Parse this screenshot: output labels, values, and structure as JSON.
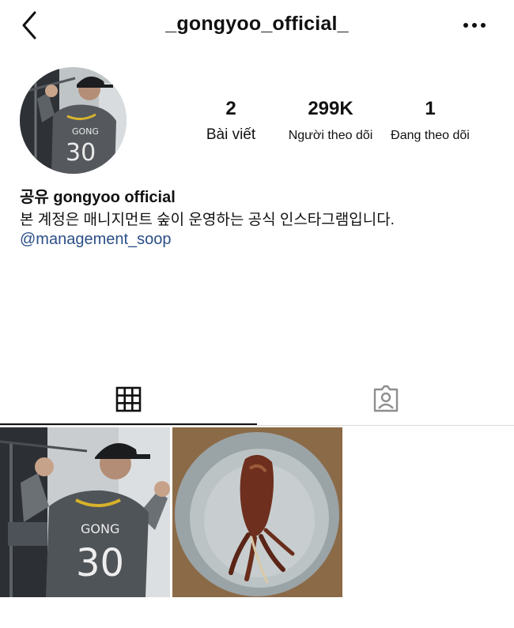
{
  "header": {
    "username": "_gongyoo_official_",
    "back_icon": "chevron-left-icon",
    "more_icon": "more-horizontal-icon"
  },
  "profile": {
    "avatar_icon": "profile-avatar",
    "stats": {
      "posts_count": "2",
      "posts_label": "Bài viết",
      "followers_count": "299K",
      "followers_label": "Người theo dõi",
      "following_count": "1",
      "following_label": "Đang theo dõi"
    },
    "display_name": "공유 gongyoo official",
    "bio": "본 계정은 매니지먼트 숲이 운영하는 공식 인스타그램입니다.",
    "mention": "@management_soop"
  },
  "tabs": [
    {
      "icon": "grid-icon",
      "active": true
    },
    {
      "icon": "tagged-person-icon",
      "active": false
    }
  ],
  "posts": [
    {
      "content": "man in jersey",
      "jersey_name": "GONG",
      "jersey_number": "30"
    },
    {
      "content": "grilled squid on plate"
    }
  ],
  "colors": {
    "link": "#2b4f86",
    "divider": "#dbdbdb",
    "text": "#111111"
  }
}
